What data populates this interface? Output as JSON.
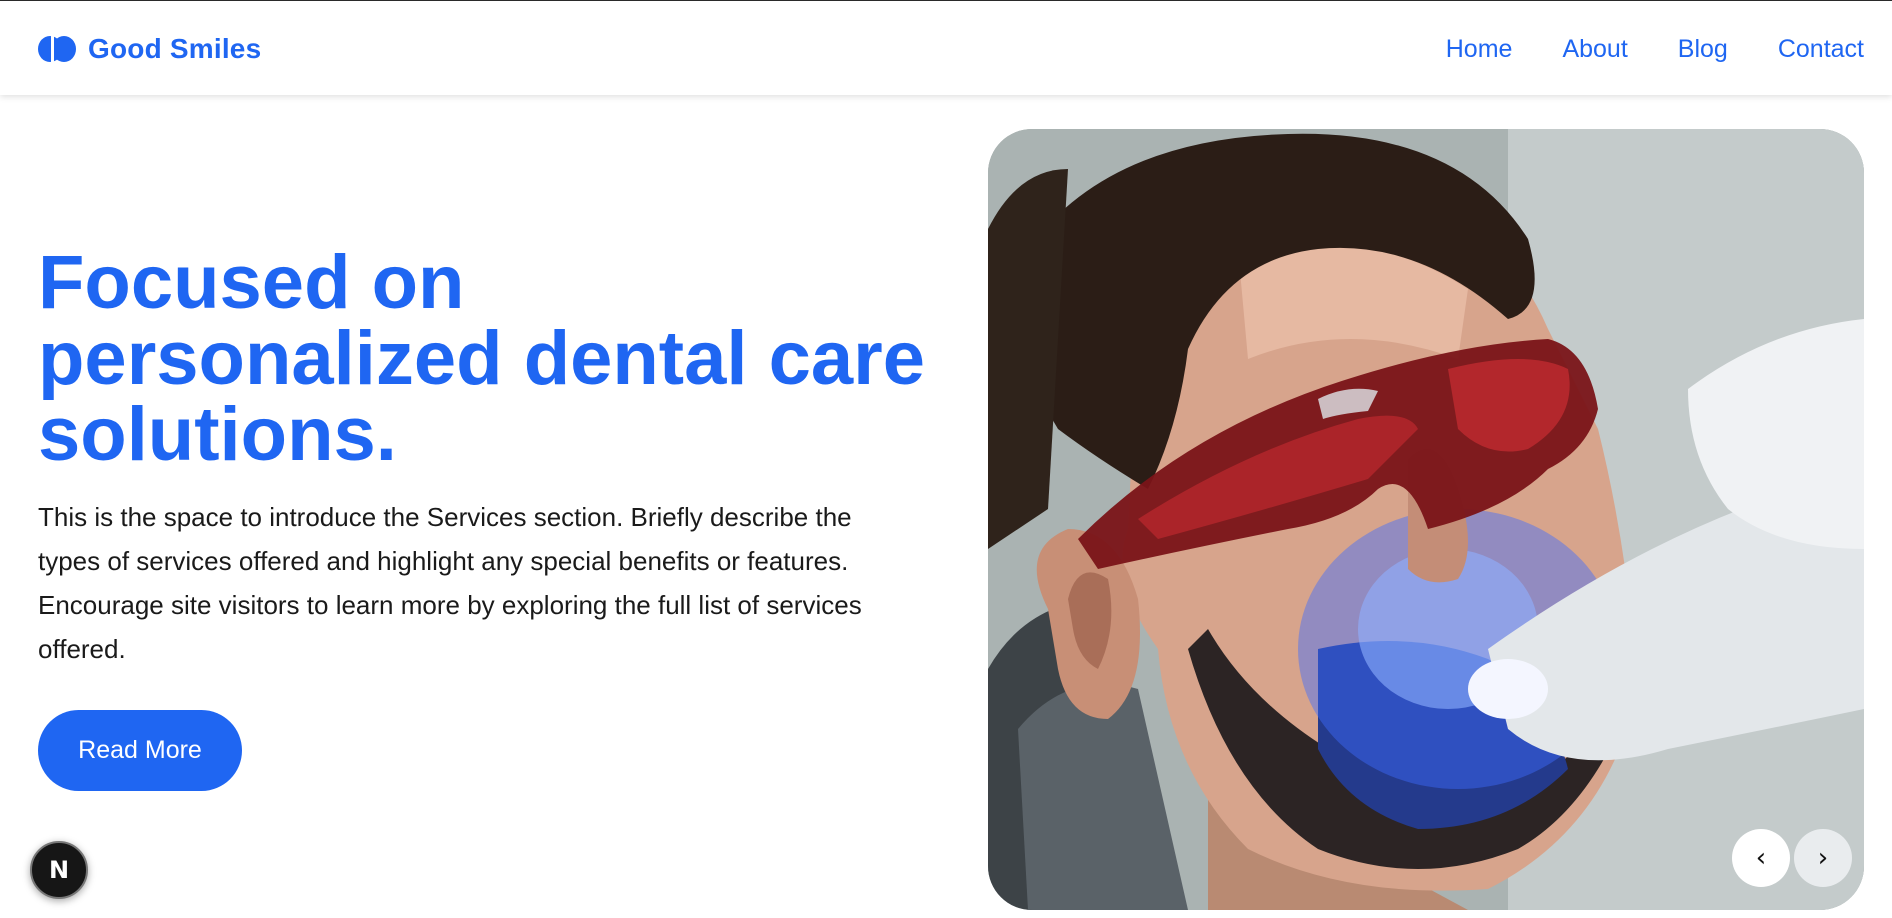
{
  "header": {
    "brand_name": "Good Smiles",
    "nav": [
      {
        "label": "Home"
      },
      {
        "label": "About"
      },
      {
        "label": "Blog"
      },
      {
        "label": "Contact"
      }
    ]
  },
  "hero": {
    "headline": "Focused on personalized dental care solutions.",
    "intro": "This is the space to introduce the Services section. Briefly describe the types of services offered and highlight any special benefits or features. Encourage site visitors to learn more by exploring the full list of services offered.",
    "cta_label": "Read More",
    "image_icon": "dental-whitening-photo",
    "prev_icon": "chevron-left-icon",
    "next_icon": "chevron-right-icon"
  },
  "dev_badge": {
    "label": "N",
    "icon": "nextjs-dev-badge"
  },
  "colors": {
    "accent": "#1f66f2",
    "text": "#1a1a1a",
    "background": "#ffffff"
  }
}
